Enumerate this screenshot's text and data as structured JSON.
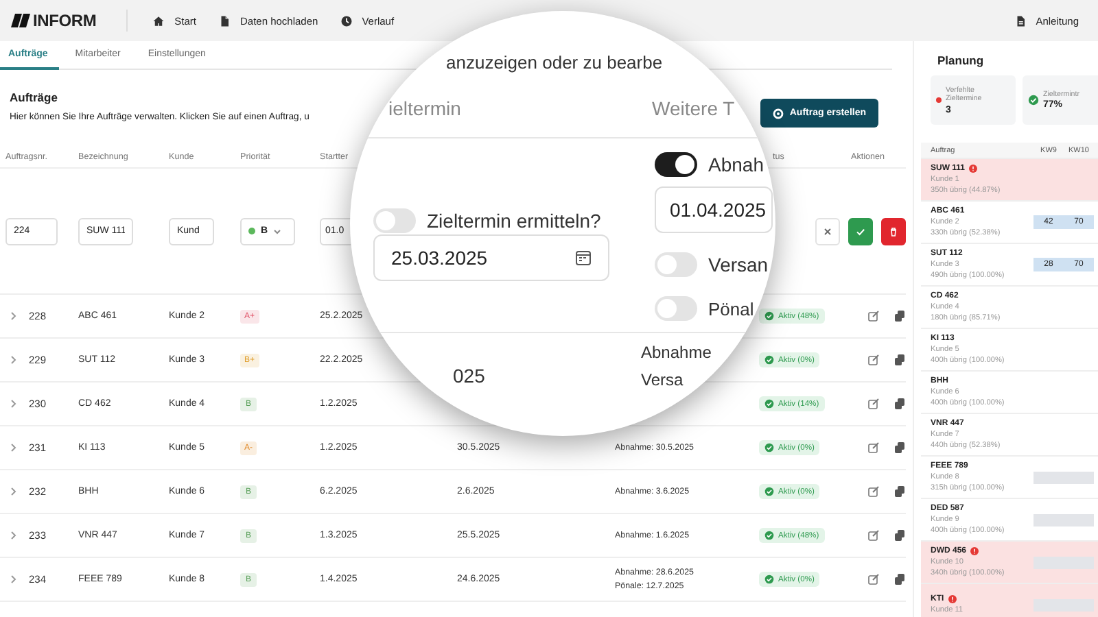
{
  "topbar": {
    "logo": "INFORM",
    "nav": [
      {
        "label": "Start"
      },
      {
        "label": "Daten hochladen"
      },
      {
        "label": "Verlauf"
      }
    ],
    "help": {
      "label": "Anleitung"
    }
  },
  "tabs": [
    {
      "label": "Aufträge",
      "selected": true
    },
    {
      "label": "Mitarbeiter",
      "selected": false
    },
    {
      "label": "Einstellungen",
      "selected": false
    }
  ],
  "page": {
    "title": "Aufträge",
    "description": "Hier können Sie Ihre Aufträge verwalten. Klicken Sie auf einen Auftrag, u",
    "create_button": "Auftrag erstellen"
  },
  "table": {
    "columns": [
      "Auftragsnr.",
      "Bezeichnung",
      "Kunde",
      "Priorität",
      "Startter",
      "tus",
      "Aktionen"
    ],
    "edit_row": {
      "number": "224",
      "name": "SUW 111",
      "customer": "Kund",
      "priority": {
        "label": "B",
        "color": "#5cb85c"
      },
      "start": "01.0",
      "actions": [
        {
          "kind": "cancel"
        },
        {
          "kind": "confirm"
        },
        {
          "kind": "delete"
        }
      ]
    },
    "rows": [
      {
        "number": "228",
        "name": "ABC 461",
        "customer": "Kunde 2",
        "priority": {
          "label": "A+",
          "color": "#e0556a"
        },
        "start": "25.2.2025",
        "status": "Aktiv (48%)"
      },
      {
        "number": "229",
        "name": "SUT 112",
        "customer": "Kunde 3",
        "priority": {
          "label": "B+",
          "color": "#e0a030"
        },
        "start": "22.2.2025",
        "status": "Aktiv (0%)"
      },
      {
        "number": "230",
        "name": "CD 462",
        "customer": "Kunde 4",
        "priority": {
          "label": "B",
          "color": "#5aa05a"
        },
        "start": "1.2.2025",
        "status": "Aktiv (14%)"
      },
      {
        "number": "231",
        "name": "KI 113",
        "customer": "Kunde 5",
        "priority": {
          "label": "A-",
          "color": "#e08a2a"
        },
        "start": "1.2.2025",
        "target": "30.5.2025",
        "milestones": [
          "Abnahme: 30.5.2025"
        ],
        "status": "Aktiv (0%)"
      },
      {
        "number": "232",
        "name": "BHH",
        "customer": "Kunde 6",
        "priority": {
          "label": "B",
          "color": "#5aa05a"
        },
        "start": "6.2.2025",
        "target": "2.6.2025",
        "milestones": [
          "Abnahme: 3.6.2025"
        ],
        "status": "Aktiv (0%)"
      },
      {
        "number": "233",
        "name": "VNR 447",
        "customer": "Kunde 7",
        "priority": {
          "label": "B",
          "color": "#5aa05a"
        },
        "start": "1.3.2025",
        "target": "25.5.2025",
        "milestones": [
          "Abnahme: 1.6.2025"
        ],
        "status": "Aktiv (48%)"
      },
      {
        "number": "234",
        "name": "FEEE 789",
        "customer": "Kunde 8",
        "priority": {
          "label": "B",
          "color": "#5aa05a"
        },
        "start": "1.4.2025",
        "target": "24.6.2025",
        "milestones": [
          "Abnahme: 28.6.2025",
          "Pönale: 12.7.2025"
        ],
        "status": "Aktiv (0%)"
      }
    ]
  },
  "lens": {
    "description_fragment": "anzuzeigen oder zu bearbe",
    "headers": [
      "ieltermin",
      "Weitere T"
    ],
    "target_toggle": {
      "label": "Zieltermin ermitteln?",
      "on": false
    },
    "target_date": "25.03.2025",
    "milestones": [
      {
        "label": "Abnah",
        "on": true,
        "date": "01.04.2025"
      },
      {
        "label": "Versan",
        "on": false
      },
      {
        "label": "Pönal",
        "on": false
      }
    ],
    "next_row": {
      "target": "025",
      "milestones": [
        "Abnahme",
        "Versa"
      ]
    }
  },
  "planning": {
    "title": "Planung",
    "stats": [
      {
        "kind": "alert",
        "label": "Verfehlte Zieltermine",
        "value": "3"
      },
      {
        "kind": "check",
        "label": "Zieltermintr",
        "value": "77%"
      }
    ],
    "columns": [
      "Auftrag",
      "KW9",
      "KW10"
    ],
    "rows": [
      {
        "name": "SUW 111",
        "customer": "Kunde 1",
        "remaining": "350h übrig (44.87%)",
        "overdue": true,
        "schedule": []
      },
      {
        "name": "ABC 461",
        "customer": "Kunde 2",
        "remaining": "330h übrig (52.38%)",
        "overdue": false,
        "schedule": [
          {
            "kind": "hours",
            "text": "42"
          },
          {
            "kind": "hours",
            "text": "70"
          }
        ]
      },
      {
        "name": "SUT 112",
        "customer": "Kunde 3",
        "remaining": "490h übrig (100.00%)",
        "overdue": false,
        "schedule": [
          {
            "kind": "hours",
            "text": "28"
          },
          {
            "kind": "hours",
            "text": "70"
          }
        ]
      },
      {
        "name": "CD 462",
        "customer": "Kunde 4",
        "remaining": "180h übrig (85.71%)",
        "overdue": false,
        "schedule": []
      },
      {
        "name": "KI 113",
        "customer": "Kunde 5",
        "remaining": "400h übrig (100.00%)",
        "overdue": false,
        "schedule": []
      },
      {
        "name": "BHH",
        "customer": "Kunde 6",
        "remaining": "400h übrig (100.00%)",
        "overdue": false,
        "schedule": []
      },
      {
        "name": "VNR 447",
        "customer": "Kunde 7",
        "remaining": "440h übrig (52.38%)",
        "overdue": false,
        "schedule": []
      },
      {
        "name": "FEEE 789",
        "customer": "Kunde 8",
        "remaining": "315h übrig (100.00%)",
        "overdue": false,
        "schedule": [
          {
            "kind": "bar"
          }
        ]
      },
      {
        "name": "DED 587",
        "customer": "Kunde 9",
        "remaining": "400h übrig (100.00%)",
        "overdue": false,
        "schedule": [
          {
            "kind": "bar"
          }
        ]
      },
      {
        "name": "DWD 456",
        "customer": "Kunde 10",
        "remaining": "340h übrig (100.00%)",
        "overdue": true,
        "schedule": [
          {
            "kind": "bar"
          }
        ]
      },
      {
        "name": "KTI",
        "customer": "Kunde 11",
        "overdue": true,
        "schedule": [
          {
            "kind": "bar"
          }
        ]
      }
    ]
  }
}
